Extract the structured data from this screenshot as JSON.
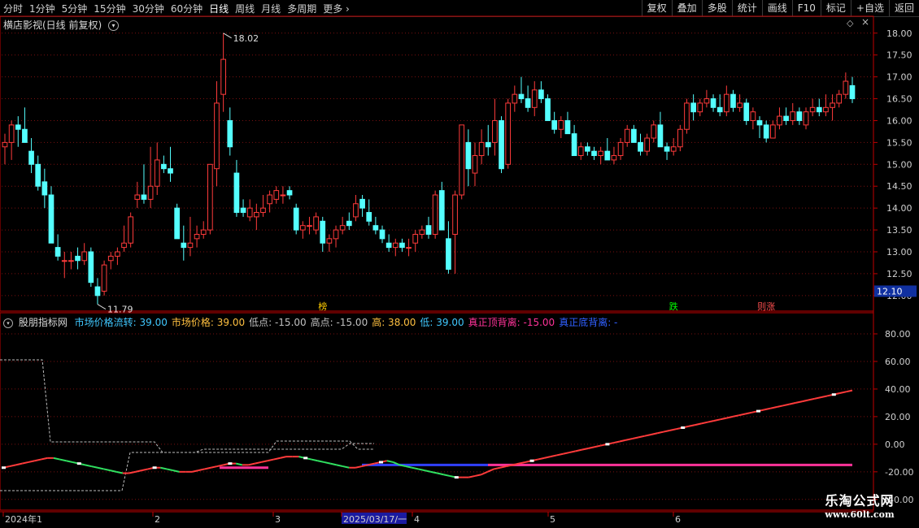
{
  "toolbar": {
    "periods": [
      "分时",
      "1分钟",
      "5分钟",
      "15分钟",
      "30分钟",
      "60分钟",
      "日线",
      "周线",
      "月线",
      "多周期"
    ],
    "active": "日线",
    "more_label": "更多",
    "right_buttons": [
      "复权",
      "叠加",
      "多股",
      "统计",
      "画线",
      "F10",
      "标记",
      "+自选",
      "返回"
    ]
  },
  "price_panel": {
    "title": "横店影视(日线 前复权)",
    "high_label": "18.02",
    "low_label": "11.79",
    "current_price": "12.10",
    "y_ticks": [
      "18.00",
      "17.50",
      "17.00",
      "16.50",
      "16.00",
      "15.50",
      "15.00",
      "14.50",
      "14.00",
      "13.50",
      "13.00",
      "12.50",
      "12.00"
    ],
    "markers": [
      {
        "text": "榜",
        "color": "#ffcc00",
        "date_index": 48
      },
      {
        "text": "跌",
        "color": "#00ff00",
        "date_index": 101
      },
      {
        "text": "则涨",
        "color": "#ff5050",
        "date_index": 115
      }
    ]
  },
  "indicator_panel": {
    "name": "股朋指标网",
    "fields": [
      {
        "label": "市场价格流转",
        "value": "39.00",
        "color": "#40c8ff"
      },
      {
        "label": "市场价格",
        "value": "39.00",
        "color": "#ffc040"
      },
      {
        "label": "低点",
        "value": "-15.00",
        "color": "#c0c0c0"
      },
      {
        "label": "高点",
        "value": "-15.00",
        "color": "#c0c0c0"
      },
      {
        "label": "高",
        "value": "38.00",
        "color": "#ffc040"
      },
      {
        "label": "低",
        "value": "39.00",
        "color": "#40c8ff"
      },
      {
        "label": "真正顶背离",
        "value": "-15.00",
        "color": "#ff3399"
      },
      {
        "label": "真正底背离",
        "value": "-",
        "color": "#3060ff"
      }
    ],
    "y_ticks": [
      "80.00",
      "60.00",
      "40.00",
      "20.00",
      "0.00",
      "-20.00",
      "-40.00"
    ]
  },
  "date_axis": {
    "labels": [
      "2024年1",
      "2",
      "3",
      "2025/03/17/一",
      "4",
      "5",
      "6"
    ]
  },
  "watermark": {
    "line1": "乐淘公式网",
    "line2": "www.60lt.com"
  },
  "colors": {
    "up": "#ff3b3b",
    "down": "#54ffff",
    "grid": "#7a1010",
    "axis": "#c00000"
  },
  "chart_data": [
    {
      "type": "candlestick",
      "title": "横店影视(日线 前复权)",
      "ylim": [
        11.7,
        18.2
      ],
      "ohlc": [
        [
          15.4,
          15.7,
          15.0,
          15.5
        ],
        [
          15.5,
          16.0,
          15.1,
          15.9
        ],
        [
          15.9,
          16.1,
          15.4,
          15.8
        ],
        [
          15.8,
          16.3,
          15.6,
          15.5
        ],
        [
          15.3,
          15.6,
          14.8,
          15.0
        ],
        [
          15.0,
          15.2,
          14.4,
          14.5
        ],
        [
          14.6,
          14.9,
          14.0,
          14.3
        ],
        [
          14.3,
          14.5,
          13.4,
          13.2
        ],
        [
          13.1,
          13.4,
          12.8,
          12.9
        ],
        [
          12.8,
          13.0,
          12.4,
          12.8
        ],
        [
          12.8,
          13.0,
          12.6,
          12.8
        ],
        [
          12.9,
          13.1,
          12.6,
          12.8
        ],
        [
          12.8,
          13.2,
          12.7,
          13.0
        ],
        [
          13.0,
          13.1,
          12.2,
          12.3
        ],
        [
          12.2,
          12.4,
          11.8,
          12.0
        ],
        [
          12.1,
          12.8,
          12.0,
          12.7
        ],
        [
          12.8,
          13.0,
          12.6,
          12.9
        ],
        [
          12.9,
          13.1,
          12.7,
          13.0
        ],
        [
          13.1,
          13.6,
          13.0,
          13.2
        ],
        [
          13.2,
          13.9,
          13.1,
          13.8
        ],
        [
          14.2,
          14.6,
          14.0,
          14.3
        ],
        [
          14.3,
          15.0,
          14.1,
          14.2
        ],
        [
          14.2,
          15.4,
          14.0,
          14.5
        ],
        [
          14.5,
          15.5,
          14.3,
          15.1
        ],
        [
          15.0,
          15.2,
          14.8,
          14.9
        ],
        [
          14.9,
          15.4,
          14.6,
          14.8
        ],
        [
          14.0,
          14.1,
          13.4,
          13.3
        ],
        [
          13.2,
          13.6,
          12.8,
          13.1
        ],
        [
          13.1,
          13.8,
          12.9,
          13.2
        ],
        [
          13.3,
          13.6,
          13.1,
          13.4
        ],
        [
          13.4,
          13.7,
          13.3,
          13.5
        ],
        [
          13.5,
          15.0,
          13.4,
          15.0
        ],
        [
          14.9,
          16.9,
          14.5,
          16.4
        ],
        [
          16.6,
          18.0,
          16.2,
          17.4
        ],
        [
          16.0,
          16.3,
          15.2,
          15.4
        ],
        [
          14.8,
          15.1,
          13.8,
          13.9
        ],
        [
          14.0,
          14.2,
          13.8,
          13.9
        ],
        [
          13.8,
          14.2,
          13.7,
          14.0
        ],
        [
          13.8,
          14.1,
          13.5,
          13.9
        ],
        [
          13.9,
          14.3,
          13.8,
          14.0
        ],
        [
          14.1,
          14.4,
          13.9,
          14.3
        ],
        [
          14.2,
          14.5,
          14.1,
          14.4
        ],
        [
          14.3,
          14.5,
          14.1,
          14.3
        ],
        [
          14.4,
          14.5,
          14.2,
          14.3
        ],
        [
          14.0,
          14.1,
          13.4,
          13.5
        ],
        [
          13.5,
          13.7,
          13.3,
          13.6
        ],
        [
          13.6,
          13.8,
          13.4,
          13.6
        ],
        [
          13.5,
          13.9,
          13.4,
          13.8
        ],
        [
          13.7,
          13.8,
          13.0,
          13.2
        ],
        [
          13.2,
          13.4,
          13.0,
          13.3
        ],
        [
          13.3,
          13.6,
          13.1,
          13.5
        ],
        [
          13.5,
          13.8,
          13.4,
          13.6
        ],
        [
          13.7,
          13.9,
          13.5,
          13.6
        ],
        [
          13.8,
          14.3,
          13.7,
          14.1
        ],
        [
          14.2,
          14.3,
          13.8,
          14.0
        ],
        [
          13.9,
          14.2,
          13.6,
          13.7
        ],
        [
          13.6,
          13.8,
          13.4,
          13.5
        ],
        [
          13.5,
          13.6,
          13.2,
          13.3
        ],
        [
          13.2,
          13.4,
          13.0,
          13.1
        ],
        [
          13.1,
          13.3,
          12.9,
          13.2
        ],
        [
          13.2,
          13.3,
          13.0,
          13.1
        ],
        [
          13.1,
          13.3,
          12.9,
          13.1
        ],
        [
          13.2,
          13.5,
          13.0,
          13.4
        ],
        [
          13.4,
          13.6,
          13.3,
          13.5
        ],
        [
          13.6,
          13.8,
          13.3,
          13.4
        ],
        [
          13.4,
          14.4,
          13.3,
          14.3
        ],
        [
          14.4,
          14.6,
          13.5,
          13.5
        ],
        [
          13.3,
          13.7,
          12.5,
          12.6
        ],
        [
          13.4,
          14.4,
          12.5,
          14.3
        ],
        [
          14.3,
          15.9,
          14.2,
          15.9
        ],
        [
          15.5,
          15.8,
          14.5,
          14.9
        ],
        [
          14.8,
          15.5,
          14.5,
          15.2
        ],
        [
          15.2,
          15.8,
          15.0,
          15.5
        ],
        [
          15.5,
          15.9,
          15.2,
          15.4
        ],
        [
          15.5,
          16.5,
          15.2,
          16.0
        ],
        [
          16.0,
          16.1,
          14.8,
          14.9
        ],
        [
          15.0,
          16.5,
          14.9,
          16.4
        ],
        [
          16.4,
          16.8,
          16.2,
          16.6
        ],
        [
          16.6,
          17.0,
          16.4,
          16.5
        ],
        [
          16.5,
          16.8,
          16.2,
          16.3
        ],
        [
          16.3,
          16.9,
          16.1,
          16.7
        ],
        [
          16.7,
          16.9,
          16.4,
          16.5
        ],
        [
          16.5,
          16.6,
          16.0,
          16.0
        ],
        [
          16.0,
          16.2,
          15.7,
          15.8
        ],
        [
          15.8,
          16.1,
          15.6,
          16.0
        ],
        [
          16.0,
          16.2,
          15.7,
          15.7
        ],
        [
          15.7,
          15.9,
          15.2,
          15.2
        ],
        [
          15.2,
          15.5,
          15.1,
          15.4
        ],
        [
          15.4,
          15.5,
          15.2,
          15.3
        ],
        [
          15.3,
          15.4,
          15.1,
          15.2
        ],
        [
          15.2,
          15.4,
          15.0,
          15.3
        ],
        [
          15.3,
          15.6,
          15.1,
          15.1
        ],
        [
          15.1,
          15.4,
          15.0,
          15.2
        ],
        [
          15.2,
          15.6,
          15.1,
          15.5
        ],
        [
          15.5,
          15.9,
          15.4,
          15.8
        ],
        [
          15.8,
          15.9,
          15.5,
          15.5
        ],
        [
          15.5,
          15.7,
          15.2,
          15.3
        ],
        [
          15.3,
          15.7,
          15.2,
          15.6
        ],
        [
          15.6,
          16.0,
          15.5,
          15.9
        ],
        [
          15.9,
          16.2,
          15.6,
          15.4
        ],
        [
          15.4,
          15.5,
          15.1,
          15.3
        ],
        [
          15.3,
          15.6,
          15.2,
          15.4
        ],
        [
          15.4,
          15.9,
          15.3,
          15.8
        ],
        [
          15.8,
          16.5,
          15.7,
          16.4
        ],
        [
          16.4,
          16.6,
          16.0,
          16.2
        ],
        [
          16.2,
          16.5,
          16.1,
          16.4
        ],
        [
          16.4,
          16.7,
          16.3,
          16.5
        ],
        [
          16.5,
          16.6,
          16.2,
          16.3
        ],
        [
          16.3,
          16.6,
          16.1,
          16.2
        ],
        [
          16.2,
          16.8,
          16.1,
          16.6
        ],
        [
          16.6,
          16.7,
          16.2,
          16.3
        ],
        [
          16.3,
          16.6,
          16.2,
          16.4
        ],
        [
          16.4,
          16.5,
          15.9,
          16.0
        ],
        [
          16.0,
          16.3,
          15.8,
          16.2
        ],
        [
          16.0,
          16.1,
          15.6,
          15.9
        ],
        [
          15.9,
          16.0,
          15.5,
          15.6
        ],
        [
          15.6,
          16.0,
          15.6,
          15.9
        ],
        [
          15.9,
          16.3,
          15.8,
          16.1
        ],
        [
          16.1,
          16.3,
          15.9,
          16.0
        ],
        [
          16.0,
          16.4,
          15.9,
          16.2
        ],
        [
          16.2,
          16.3,
          15.9,
          16.0
        ],
        [
          15.9,
          16.3,
          15.8,
          16.2
        ],
        [
          16.2,
          16.5,
          16.1,
          16.3
        ],
        [
          16.3,
          16.5,
          16.1,
          16.2
        ],
        [
          16.2,
          16.6,
          16.1,
          16.3
        ],
        [
          16.3,
          16.6,
          16.0,
          16.4
        ],
        [
          16.4,
          16.7,
          16.3,
          16.6
        ],
        [
          16.6,
          17.1,
          16.5,
          16.9
        ],
        [
          16.8,
          17.0,
          16.4,
          16.5
        ]
      ]
    },
    {
      "type": "line",
      "ylim": [
        -46,
        90
      ],
      "series": [
        {
          "name": "市场价格流转",
          "color": "#40c8ff",
          "values": [
            -17,
            -16,
            -15,
            -14,
            -13,
            -12,
            -11,
            -10,
            -10,
            -11,
            -12,
            -13,
            -14,
            -15,
            -16,
            -17,
            -18,
            -19,
            -20,
            -21,
            -21,
            -20,
            -19,
            -18,
            -17,
            -17,
            -18,
            -19,
            -20,
            -20,
            -20,
            -19,
            -18,
            -17,
            -16,
            -15,
            -14,
            -14,
            -15,
            -15,
            -14,
            -13,
            -12,
            -11,
            -10,
            -9,
            -9,
            -9,
            -10,
            -11,
            -12,
            -13,
            -14,
            -15,
            -16,
            -17,
            -17,
            -16,
            -15,
            -14,
            -13,
            -12,
            -13,
            -15,
            -16,
            -17,
            -18,
            -19,
            -20,
            -21,
            -22,
            -23,
            -24,
            -24,
            -24,
            -23,
            -22,
            -20,
            -18,
            -17,
            -16,
            -15,
            -14,
            -13,
            -12,
            -11,
            -10,
            -9,
            -8,
            -7,
            -6,
            -5,
            -4,
            -3,
            -2,
            -1,
            0,
            1,
            2,
            3,
            4,
            5,
            6,
            7,
            8,
            9,
            10,
            11,
            12,
            13,
            14,
            15,
            16,
            17,
            18,
            19,
            20,
            21,
            22,
            23,
            24,
            25,
            26,
            27,
            28,
            29,
            30,
            31,
            32,
            33,
            34,
            35,
            36,
            37,
            38,
            39
          ]
        }
      ]
    }
  ]
}
